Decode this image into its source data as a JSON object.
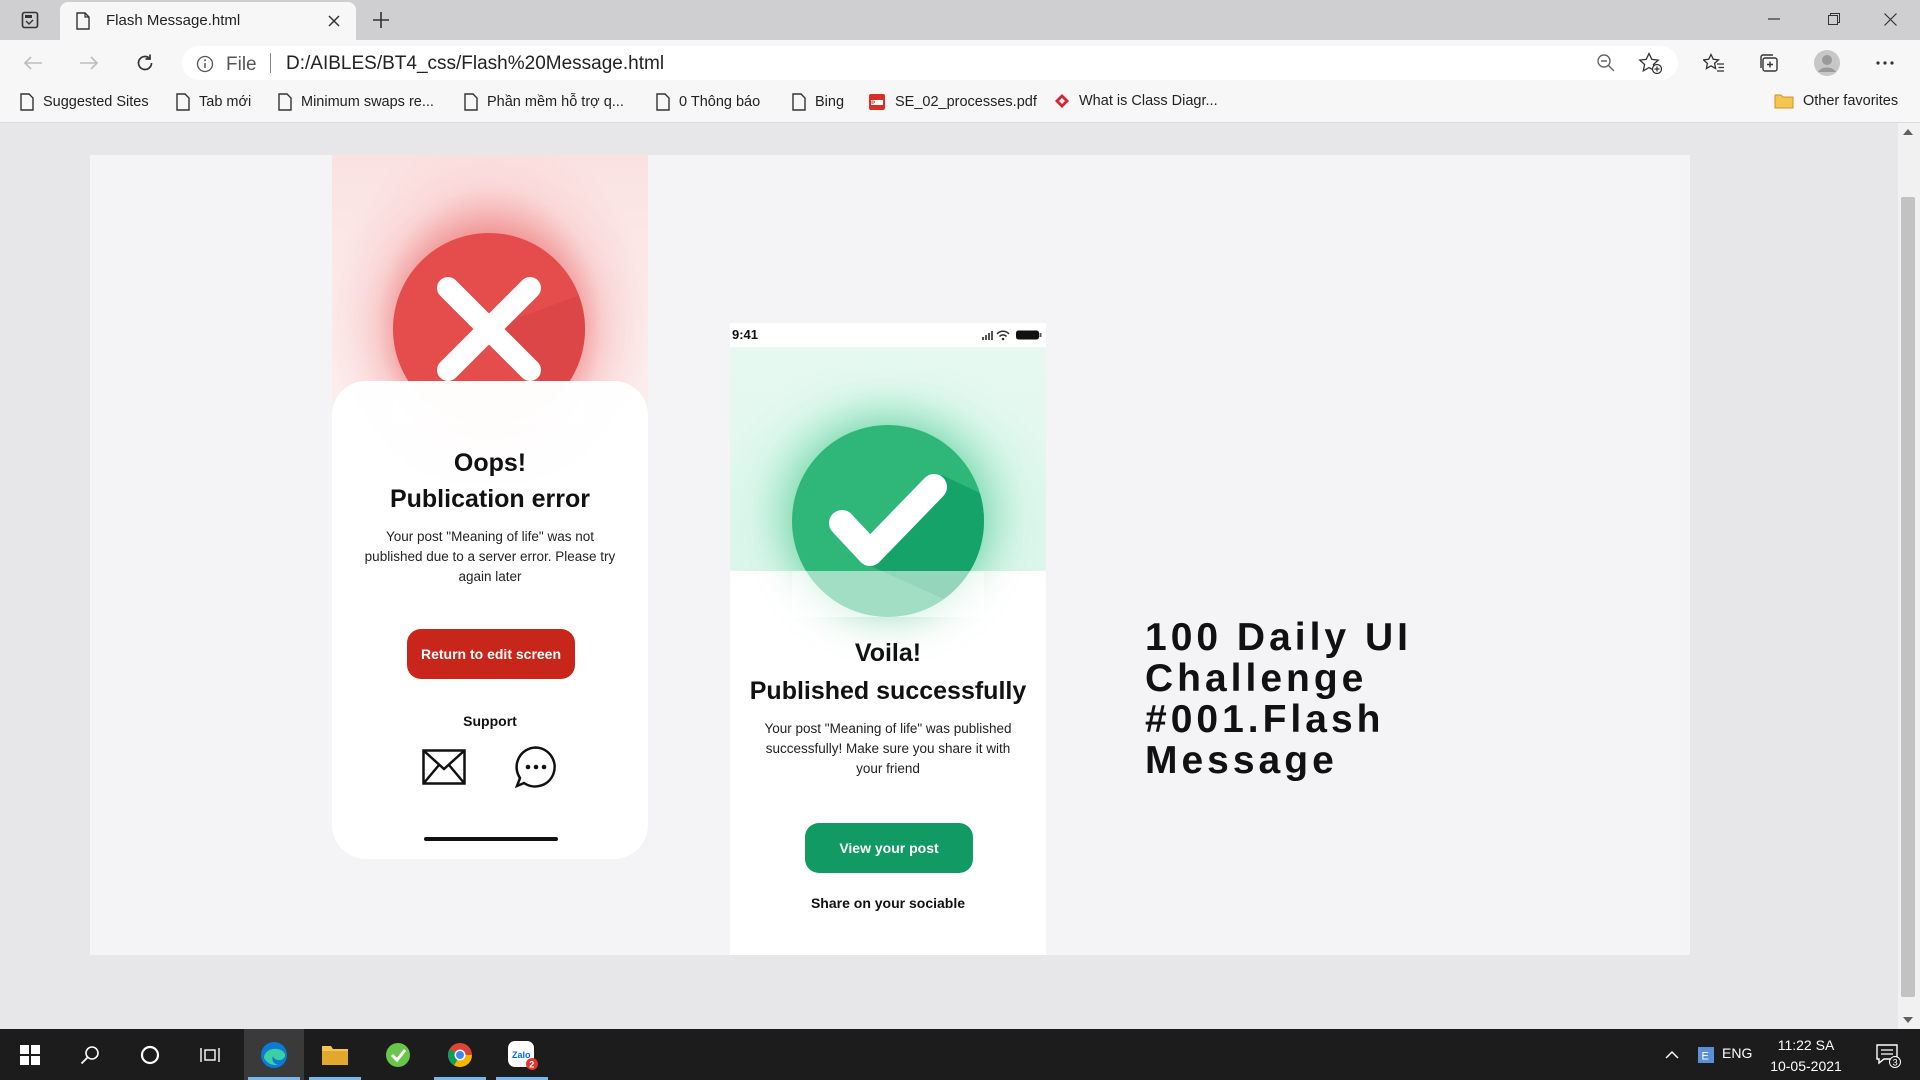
{
  "browser": {
    "tab_title": "Flash Message.html",
    "address_scheme": "File",
    "address_url": "D:/AIBLES/BT4_css/Flash%20Message.html",
    "favorites": [
      {
        "label": "Suggested Sites",
        "icon": "page-icon"
      },
      {
        "label": "Tab mới",
        "icon": "page-icon"
      },
      {
        "label": "Minimum swaps re...",
        "icon": "page-icon"
      },
      {
        "label": "Phần mềm hỗ trợ q...",
        "icon": "page-icon"
      },
      {
        "label": "0 Thông báo",
        "icon": "page-icon"
      },
      {
        "label": "Bing",
        "icon": "page-icon"
      },
      {
        "label": "SE_02_processes.pdf",
        "icon": "pdf-icon"
      },
      {
        "label": "What is Class Diagr...",
        "icon": "diamond-icon"
      }
    ],
    "other_favorites": "Other favorites"
  },
  "page": {
    "error_card": {
      "title_line1": "Oops!",
      "title_line2": "Publication error",
      "body": "Your post \"Meaning of life\" was not published due to a server error. Please try again later",
      "button": "Return to edit screen",
      "support": "Support",
      "accent": "#c8261b"
    },
    "success_card": {
      "time": "9:41",
      "title_line1": "Voila!",
      "title_line2": "Published successfully",
      "body": "Your post \"Meaning of life\" was published successfully! Make sure you share it with your friend",
      "button": "View your post",
      "share": "Share on your sociable",
      "accent": "#119a63"
    },
    "headline": "100 Daily UI Challenge #001.Flash Message"
  },
  "taskbar": {
    "language": "ENG",
    "time": "11:22 SA",
    "date": "10-05-2021",
    "notifications": "3",
    "zalo_badge": "2"
  }
}
